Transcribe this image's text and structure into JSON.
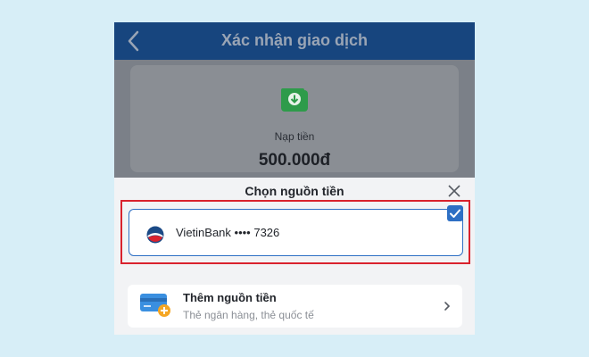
{
  "header": {
    "title": "Xác nhận giao dịch"
  },
  "transaction": {
    "type_label": "Nạp tiền",
    "amount": "500.000đ"
  },
  "sheet": {
    "title": "Chọn nguồn tiền",
    "selected_source": {
      "label": "VietinBank •••• 7326"
    },
    "add_source": {
      "title": "Thêm nguồn tiền",
      "subtitle": "Thẻ ngân hàng, thẻ quốc tế"
    }
  },
  "colors": {
    "header_bg": "#17457e",
    "selection_border": "#2d6fc4",
    "highlight_frame": "#d9222d",
    "wallet_icon": "#2e9b4a",
    "add_card_icon": "#3a8fe0",
    "add_plus_badge": "#f5a623"
  },
  "icons": {
    "back": "back-arrow-icon",
    "wallet": "wallet-download-icon",
    "close": "close-icon",
    "check": "check-icon",
    "bank_logo": "vietinbank-logo-icon",
    "add_card": "card-add-icon",
    "chevron": "chevron-right-icon"
  }
}
